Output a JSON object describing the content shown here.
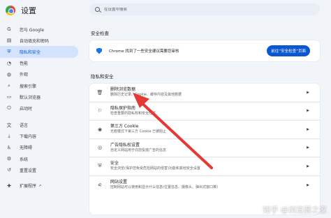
{
  "app": {
    "title": "设置"
  },
  "search": {
    "placeholder": "在设置中搜索"
  },
  "sidebar": {
    "items": [
      {
        "label": "您与 Google",
        "icon": "google-g-icon",
        "glyph": "G"
      },
      {
        "label": "自动填充和密码",
        "icon": "clipboard-icon",
        "glyph": "▤"
      },
      {
        "label": "隐私和安全",
        "icon": "shield-icon",
        "glyph": "⛨",
        "active": true
      },
      {
        "label": "性能",
        "icon": "speedometer-icon",
        "glyph": "◔"
      },
      {
        "label": "外观",
        "icon": "palette-icon",
        "glyph": "◍"
      },
      {
        "label": "搜索引擎",
        "icon": "search-icon",
        "glyph": "⌕"
      },
      {
        "label": "默认浏览器",
        "icon": "browser-icon",
        "glyph": "▭"
      },
      {
        "label": "启动时",
        "icon": "power-icon",
        "glyph": "⏻"
      }
    ],
    "items2": [
      {
        "label": "语言",
        "icon": "translate-icon",
        "glyph": "文"
      },
      {
        "label": "下载内容",
        "icon": "download-icon",
        "glyph": "⤓"
      },
      {
        "label": "无障碍",
        "icon": "accessibility-icon",
        "glyph": "♿"
      },
      {
        "label": "系统",
        "icon": "wrench-icon",
        "glyph": "⚙"
      },
      {
        "label": "重置设置",
        "icon": "reset-icon",
        "glyph": "↺"
      }
    ],
    "extensions": {
      "label": "扩展程序",
      "icon": "puzzle-icon",
      "glyph": "✚"
    }
  },
  "safety_check": {
    "section_title": "安全检查",
    "message": "Chrome 找到了一些安全建议需要您审核",
    "button_label": "前往“安全检查”页面"
  },
  "privacy": {
    "section_title": "隐私和安全",
    "rows": [
      {
        "title": "删除浏览数据",
        "subtitle": "删除历史记录、Cookie、缓存内容及其他数据",
        "icon": "trash-icon",
        "glyph": "🗑"
      },
      {
        "title": "隐私保护指南",
        "subtitle": "检查重要的隐私权和安全控件",
        "icon": "privacy-guide-icon",
        "glyph": "⚐"
      },
      {
        "title": "第三方 Cookie",
        "subtitle": "无痕模式下第三方 Cookie 已被阻止",
        "icon": "cookie-icon",
        "glyph": "◉"
      },
      {
        "title": "广告隐私权设置",
        "subtitle": "自定义网站用于向您投放广告的信息",
        "icon": "ads-icon",
        "glyph": "◎"
      },
      {
        "title": "安全",
        "subtitle": "安全浏览(保护您免受危险网站的侵害)功能和其他安全设置",
        "icon": "shield-icon",
        "glyph": "⛨"
      },
      {
        "title": "网站设置",
        "subtitle": "控制网站可以使用和显示什么信息(位置信息、摄像头、弹出式窗口等)",
        "icon": "sliders-icon",
        "glyph": "⚟"
      }
    ]
  },
  "annotation": {
    "arrow_color": "#e53935"
  },
  "watermark": {
    "text": "知乎 @浏览器之家"
  },
  "colors": {
    "accent": "#0b57d0",
    "active_bg": "#d3e3fd",
    "page_bg": "#f1f4f9"
  }
}
